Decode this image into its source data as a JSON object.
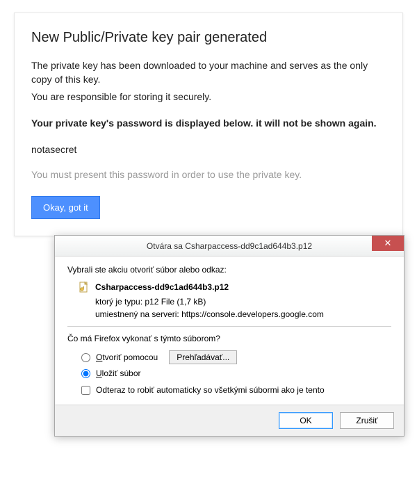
{
  "card": {
    "title": "New Public/Private key pair generated",
    "line1": "The private key has been downloaded to your machine and serves as the only copy of this key.",
    "line2": "You are responsible for storing it securely.",
    "bold": "Your private key's password is displayed below. it will not be shown again.",
    "password": "notasecret",
    "muted": "You must present this password in order to use the private key.",
    "ok_label": "Okay, got it"
  },
  "dialog": {
    "title": "Otvára sa Csharpaccess-dd9c1ad644b3.p12",
    "close_glyph": "✕",
    "intro": "Vybrali ste akciu otvoriť súbor alebo odkaz:",
    "filename": "Csharpaccess-dd9c1ad644b3.p12",
    "type_label": "ktorý je typu:",
    "type_value": "p12 File (1,7 kB)",
    "loc_label": "umiestnený na serveri:",
    "loc_value": "https://console.developers.google.com",
    "question": "Čo má Firefox vykonať s týmto súborom?",
    "open_label": "Otvoriť pomocou",
    "browse_label": "Prehľadávať...",
    "save_label": "Uložiť súbor",
    "auto_label": "Odteraz to robiť automaticky so všetkými súbormi ako je tento",
    "ok": "OK",
    "cancel": "Zrušiť"
  }
}
